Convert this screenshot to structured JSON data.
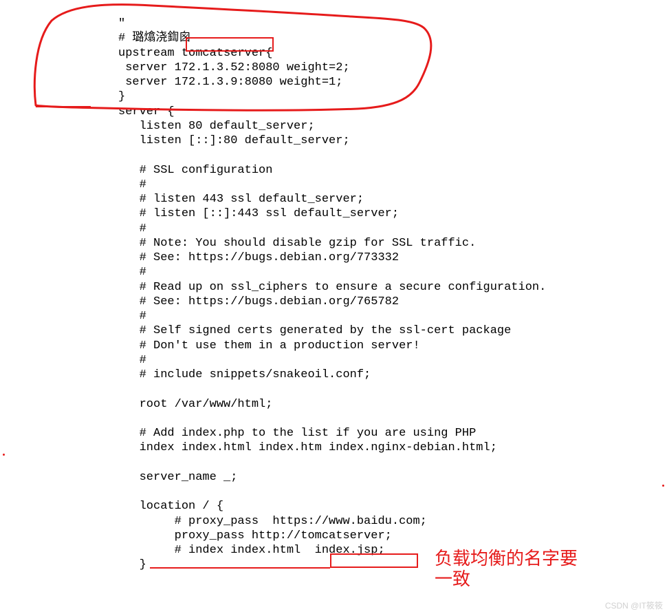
{
  "code": {
    "line1": "\"",
    "line2": "# 璐熻浇鍧囪　",
    "line3_pre": "upstream ",
    "line3_box": "tomcatserver",
    "line3_post": "{",
    "line4": " server 172.1.3.52:8080 weight=2;",
    "line5": " server 172.1.3.9:8080 weight=1;",
    "line6": "}",
    "line7": "server {",
    "line8": "   listen 80 default_server;",
    "line9": "   listen [::]:80 default_server;",
    "line10": "",
    "line11": "   # SSL configuration",
    "line12": "   #",
    "line13": "   # listen 443 ssl default_server;",
    "line14": "   # listen [::]:443 ssl default_server;",
    "line15": "   #",
    "line16": "   # Note: You should disable gzip for SSL traffic.",
    "line17": "   # See: https://bugs.debian.org/773332",
    "line18": "   #",
    "line19": "   # Read up on ssl_ciphers to ensure a secure configuration.",
    "line20": "   # See: https://bugs.debian.org/765782",
    "line21": "   #",
    "line22": "   # Self signed certs generated by the ssl-cert package",
    "line23": "   # Don't use them in a production server!",
    "line24": "   #",
    "line25": "   # include snippets/snakeoil.conf;",
    "line26": "",
    "line27": "   root /var/www/html;",
    "line28": "",
    "line29": "   # Add index.php to the list if you are using PHP",
    "line30": "   index index.html index.htm index.nginx-debian.html;",
    "line31": "",
    "line32": "   server_name _;",
    "line33": "",
    "line34": "   location / {",
    "line35": "        # proxy_pass  https://www.baidu.com;",
    "line36_pre": "        proxy_pass http://",
    "line36_box": "tomcatserver",
    "line36_post": ";",
    "line37": "        # index index.html  index.jsp;",
    "line38": "   }"
  },
  "annotation": {
    "text_line1": "负载均衡的名字要",
    "text_line2": "一致"
  },
  "watermark": "CSDN @IT筱筱"
}
